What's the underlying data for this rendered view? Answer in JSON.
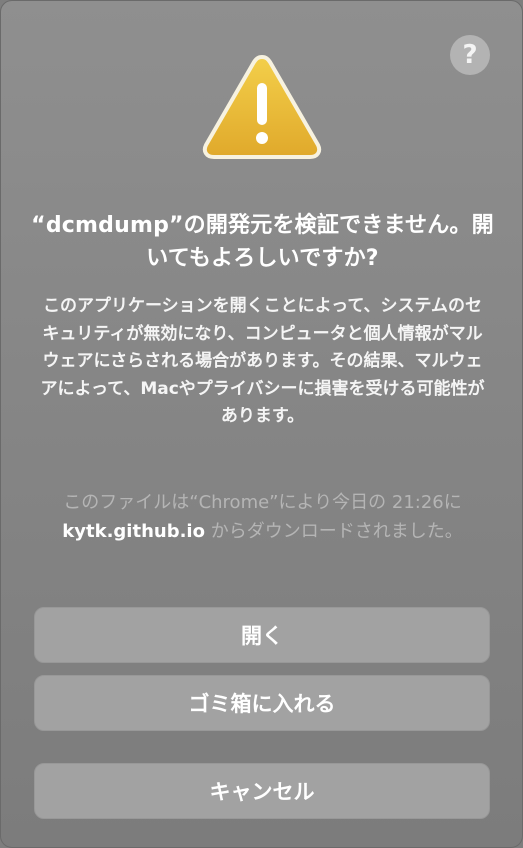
{
  "dialog": {
    "help_label": "?",
    "icon": "warning-triangle-icon",
    "title": "“dcmdump”の開発元を検証できません。開いてもよろしいですか?",
    "message": "このアプリケーションを開くことによって、システムのセキュリティが無効になり、コンピュータと個人情報がマルウェアにさらされる場合があります。その結果、マルウェアによって、Macやプライバシーに損害を受ける可能性があります。",
    "origin": {
      "prefix": "このファイルは“Chrome”により今日の 21:26に ",
      "host": "kytk.github.io",
      "suffix": " からダウンロードされました。"
    },
    "buttons": {
      "open": "開く",
      "trash": "ゴミ箱に入れる",
      "cancel": "キャンセル"
    }
  }
}
